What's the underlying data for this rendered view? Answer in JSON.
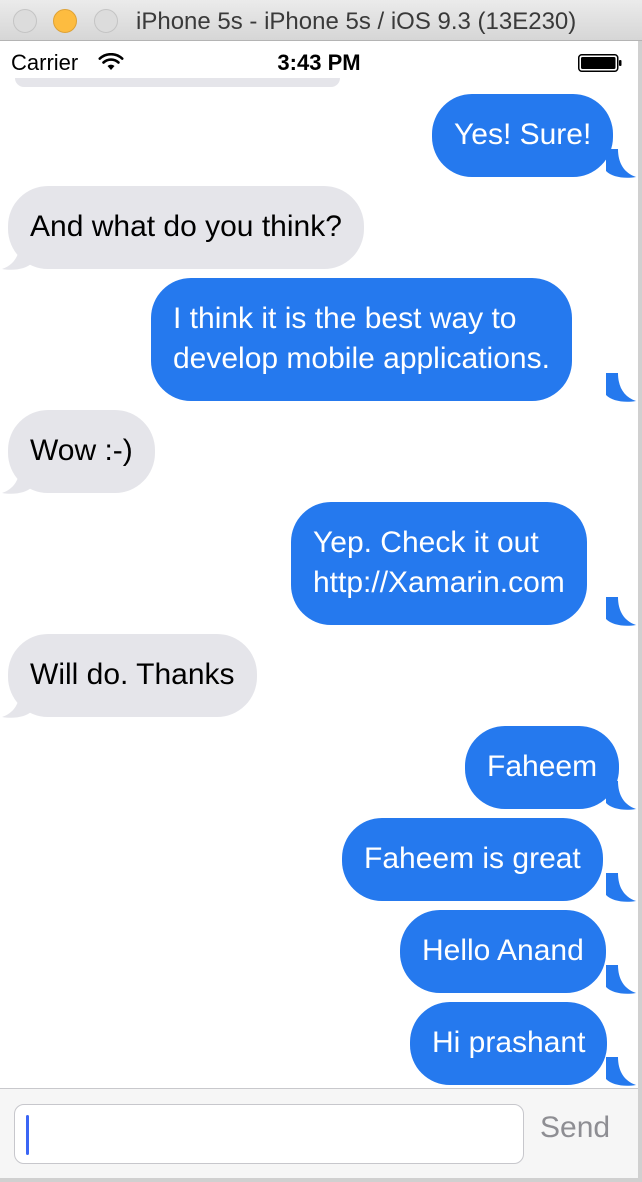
{
  "window": {
    "title": "iPhone 5s - iPhone 5s / iOS 9.3 (13E230)"
  },
  "status_bar": {
    "carrier": "Carrier",
    "time": "3:43 PM"
  },
  "messages": [
    {
      "direction": "outgoing",
      "text": "Yes! Sure!"
    },
    {
      "direction": "incoming",
      "text": "And what do you think?"
    },
    {
      "direction": "outgoing",
      "lines": [
        "I think it is the best way to",
        "develop mobile applications."
      ]
    },
    {
      "direction": "incoming",
      "text": "Wow :-)"
    },
    {
      "direction": "outgoing",
      "lines": [
        "Yep. Check it out",
        "http://Xamarin.com"
      ]
    },
    {
      "direction": "incoming",
      "text": "Will do. Thanks"
    },
    {
      "direction": "outgoing",
      "text": "Faheem"
    },
    {
      "direction": "outgoing",
      "text": "Faheem is great"
    },
    {
      "direction": "outgoing",
      "text": "Hello Anand"
    },
    {
      "direction": "outgoing",
      "text": "Hi prashant"
    }
  ],
  "composer": {
    "input_value": "",
    "placeholder": "",
    "send_label": "Send"
  },
  "colors": {
    "outgoing_bubble": "#2579ee",
    "incoming_bubble": "#e5e5ea",
    "send_disabled": "#8e8e93"
  }
}
